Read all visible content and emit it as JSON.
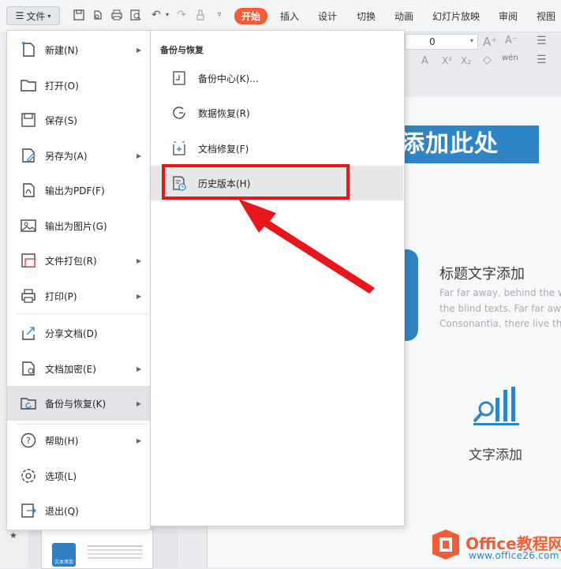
{
  "toolbar": {
    "file_label": "文件",
    "tabs": [
      "开始",
      "插入",
      "设计",
      "切换",
      "动画",
      "幻灯片放映",
      "审阅",
      "视图"
    ],
    "font_size_value": "0"
  },
  "file_menu": {
    "items": [
      {
        "label": "新建(N)",
        "icon": "new-doc-icon",
        "has_arrow": true
      },
      {
        "label": "打开(O)",
        "icon": "folder-icon",
        "has_arrow": false
      },
      {
        "label": "保存(S)",
        "icon": "save-icon",
        "has_arrow": false
      },
      {
        "label": "另存为(A)",
        "icon": "save-as-icon",
        "has_arrow": true
      },
      {
        "label": "输出为PDF(F)",
        "icon": "pdf-icon",
        "has_arrow": false
      },
      {
        "label": "输出为图片(G)",
        "icon": "image-icon",
        "has_arrow": false
      },
      {
        "label": "文件打包(R)",
        "icon": "package-icon",
        "has_arrow": true
      },
      {
        "label": "打印(P)",
        "icon": "printer-icon",
        "has_arrow": true
      },
      {
        "label": "分享文档(D)",
        "icon": "share-icon",
        "has_arrow": false
      },
      {
        "label": "文档加密(E)",
        "icon": "lock-doc-icon",
        "has_arrow": true
      },
      {
        "label": "备份与恢复(K)",
        "icon": "backup-icon",
        "has_arrow": true,
        "highlighted": true
      },
      {
        "label": "帮助(H)",
        "icon": "help-icon",
        "has_arrow": true
      },
      {
        "label": "选项(L)",
        "icon": "gear-icon",
        "has_arrow": false
      },
      {
        "label": "退出(Q)",
        "icon": "exit-icon",
        "has_arrow": false
      }
    ]
  },
  "submenu": {
    "header": "备份与恢复",
    "items": [
      {
        "label": "备份中心(K)...",
        "icon": "backup-center-icon"
      },
      {
        "label": "数据恢复(R)",
        "icon": "data-recovery-icon"
      },
      {
        "label": "文档修复(F)",
        "icon": "doc-repair-icon"
      },
      {
        "label": "历史版本(H)",
        "icon": "history-version-icon",
        "highlighted": true
      }
    ]
  },
  "slide": {
    "title": "添加此处",
    "subtitle": "标题文字添加",
    "lorem_lines": [
      "Far far away, behind the w",
      "the blind texts. Far far awa",
      "Consonantia, there live the"
    ],
    "caption": "文字添加",
    "thumb_badge": "文本添加"
  },
  "watermark": {
    "brand_main": "Office教程网",
    "url": "www.office26.com"
  },
  "colors": {
    "accent": "#f25d35",
    "slide_blue": "#2e85c6",
    "highlight_red": "#e8161a"
  }
}
